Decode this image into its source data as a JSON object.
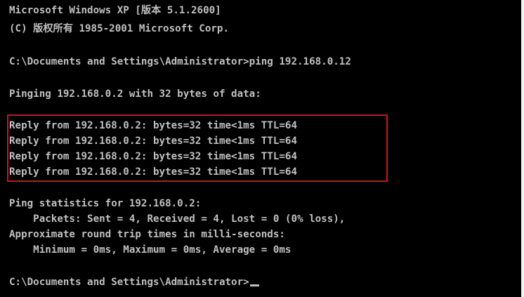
{
  "console": {
    "header": {
      "os_line": "Microsoft Windows XP [版本 5.1.2600]",
      "copyright_line": "(C) 版权所有 1985-2001 Microsoft Corp."
    },
    "command_line": "C:\\Documents and Settings\\Administrator>ping 192.168.0.12",
    "pinging_line": "Pinging 192.168.0.2 with 32 bytes of data:",
    "replies": [
      "Reply from 192.168.0.2: bytes=32 time<1ms TTL=64",
      "Reply from 192.168.0.2: bytes=32 time<1ms TTL=64",
      "Reply from 192.168.0.2: bytes=32 time<1ms TTL=64",
      "Reply from 192.168.0.2: bytes=32 time<1ms TTL=64"
    ],
    "statistics": {
      "title": "Ping statistics for 192.168.0.2:",
      "packets": "    Packets: Sent = 4, Received = 4, Lost = 0 (0% loss),",
      "rtt_title": "Approximate round trip times in milli-seconds:",
      "rtt_values": "    Minimum = 0ms, Maximum = 0ms, Average = 0ms"
    },
    "prompt": "C:\\Documents and Settings\\Administrator>"
  },
  "colors": {
    "background": "#000000",
    "text": "#c0c0c0",
    "highlight": "#c8161d"
  }
}
